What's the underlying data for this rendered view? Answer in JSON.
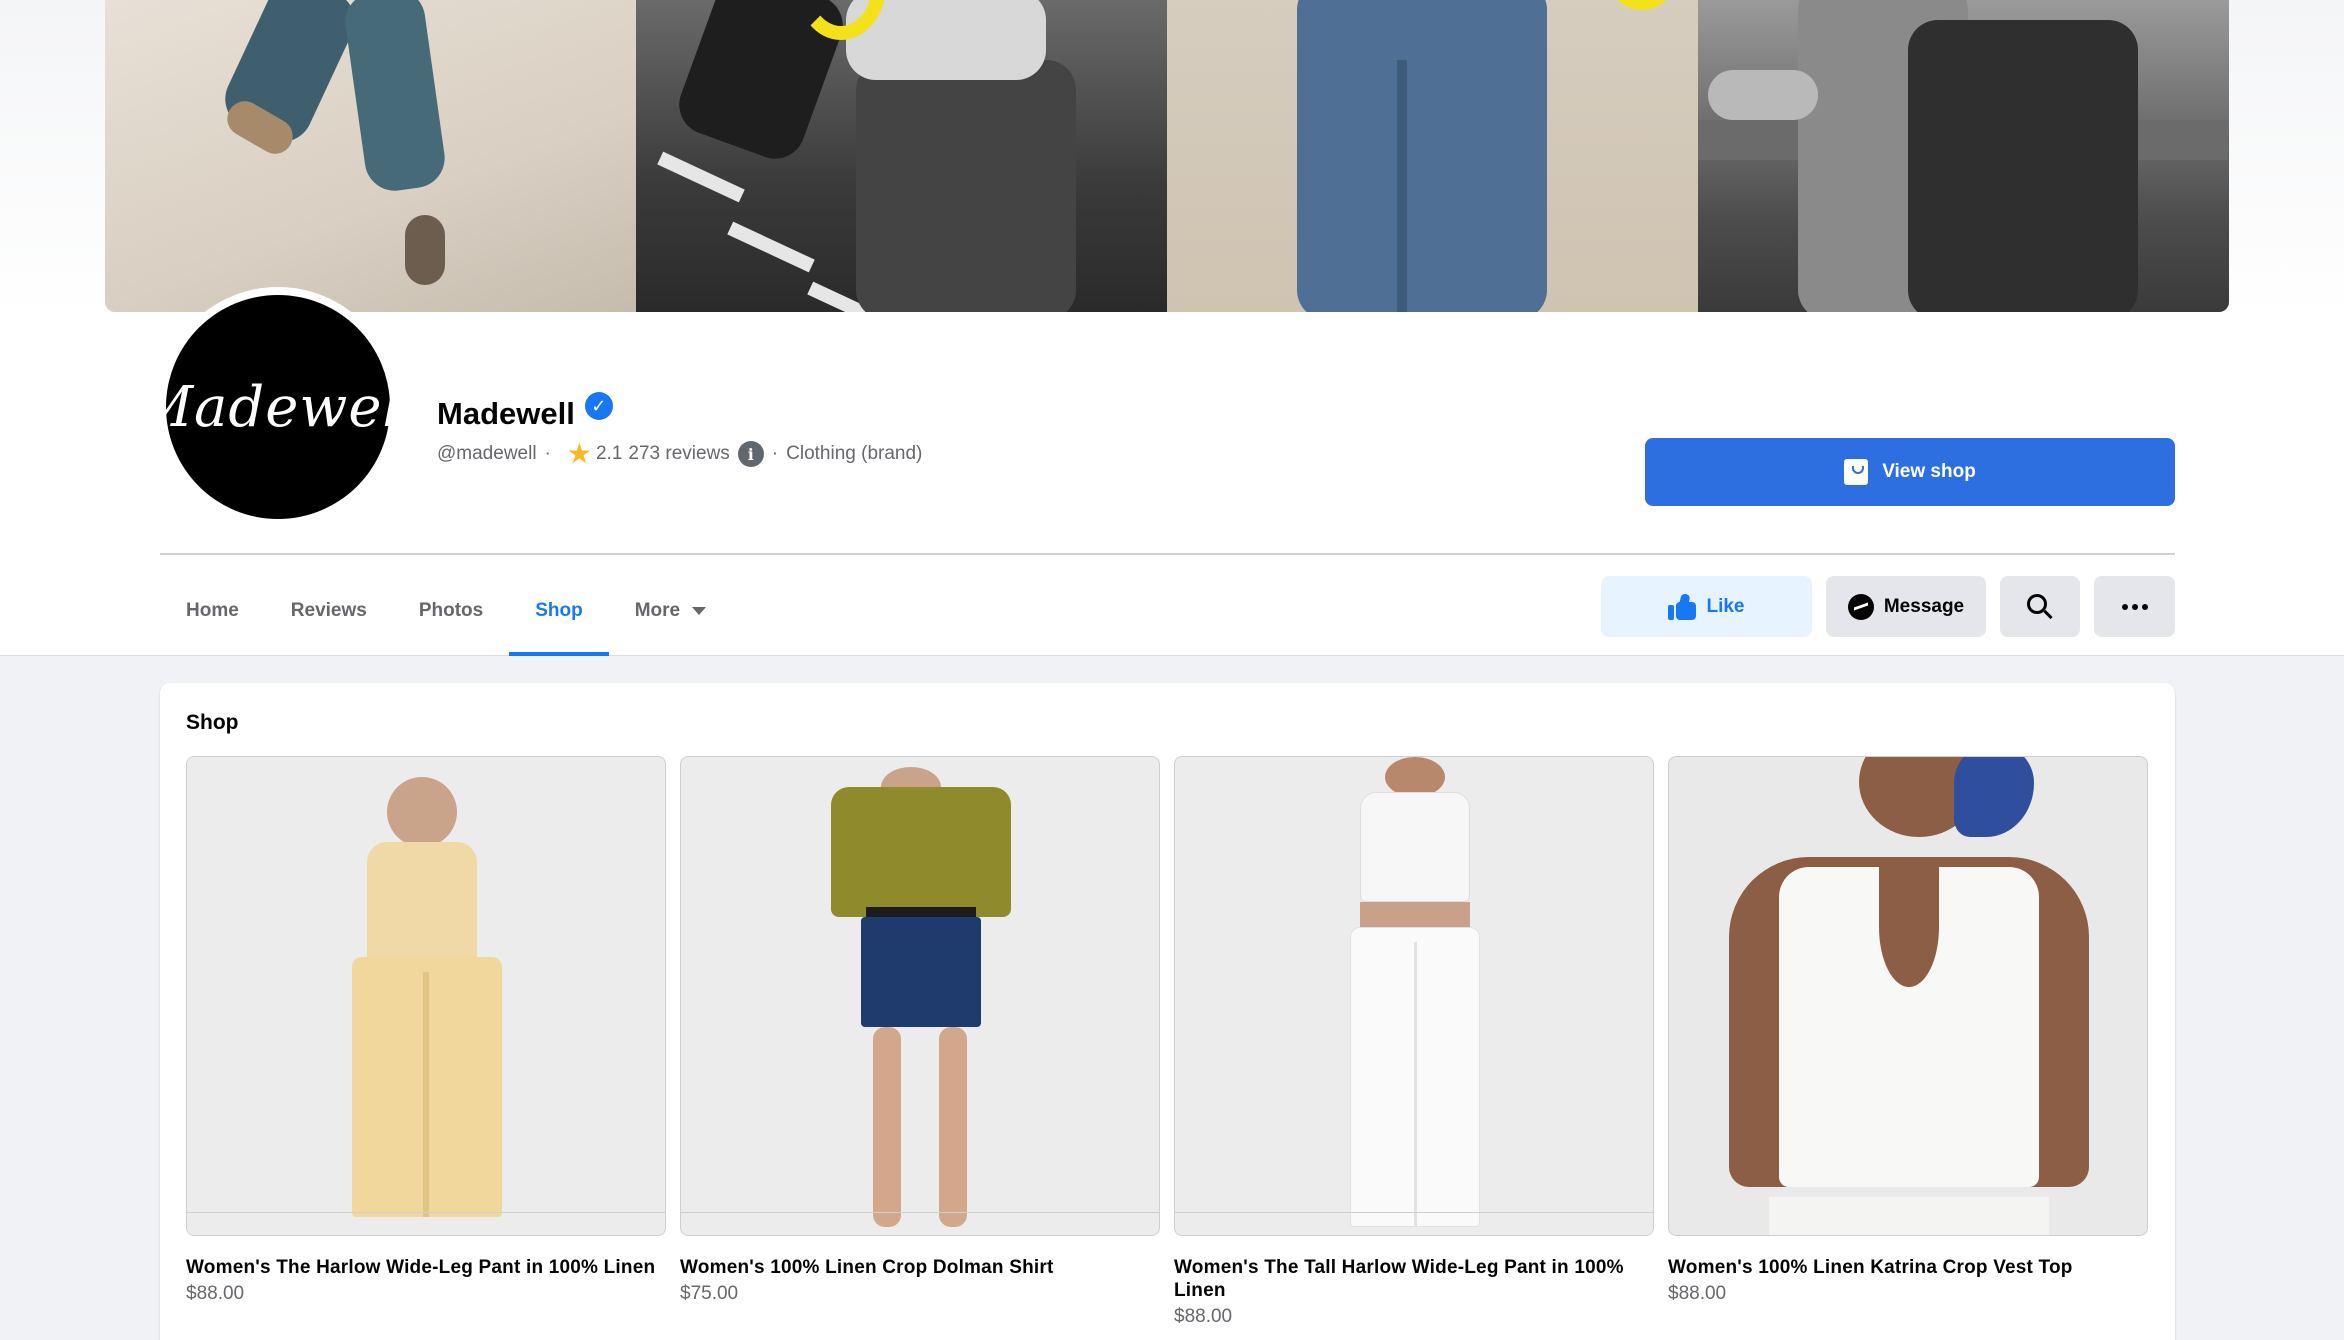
{
  "page": {
    "name": "Madewell",
    "logo_text": "Madewell",
    "handle": "@madewell",
    "rating": "2.1",
    "reviews": "273 reviews",
    "category": "Clothing (brand)",
    "separator": "·"
  },
  "actions": {
    "view_shop": "View shop",
    "like": "Like",
    "message": "Message"
  },
  "tabs": [
    {
      "label": "Home",
      "active": false
    },
    {
      "label": "Reviews",
      "active": false
    },
    {
      "label": "Photos",
      "active": false
    },
    {
      "label": "Shop",
      "active": true
    },
    {
      "label": "More",
      "active": false
    }
  ],
  "shop": {
    "title": "Shop",
    "products": [
      {
        "name": "Women's The Harlow Wide-Leg Pant in 100% Linen",
        "price": "$88.00"
      },
      {
        "name": "Women's 100% Linen Crop Dolman Shirt",
        "price": "$75.00"
      },
      {
        "name": "Women's The Tall Harlow Wide-Leg Pant in 100% Linen",
        "price": "$88.00"
      },
      {
        "name": "Women's 100% Linen Katrina Crop Vest Top",
        "price": "$88.00"
      }
    ]
  },
  "colors": {
    "accent": "#1877f2",
    "view_shop_bg": "#2d6fe0",
    "like_bg": "#e7f3ff",
    "secondary_bg": "#e4e6eb",
    "muted_text": "#65676b",
    "rating_star": "#f7b928"
  }
}
